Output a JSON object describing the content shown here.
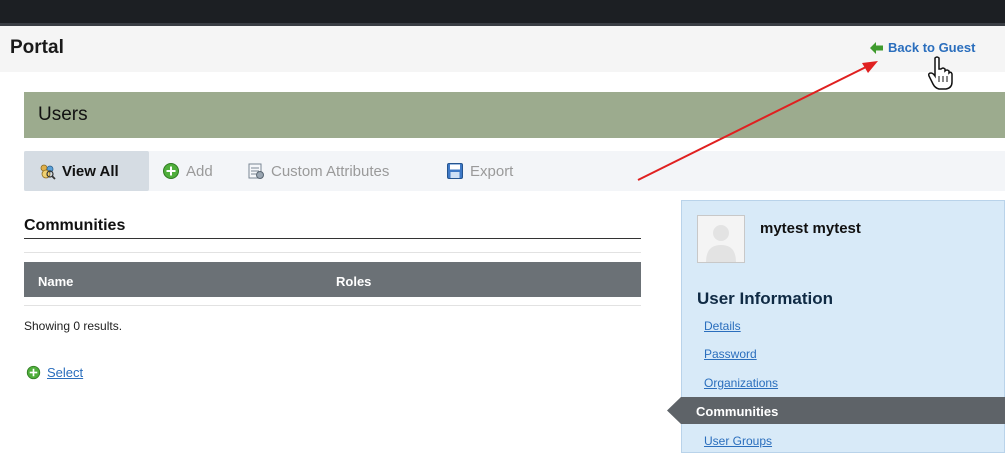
{
  "header": {
    "title": "Portal",
    "back_link": "Back to Guest"
  },
  "section": {
    "title": "Users"
  },
  "toolbar": {
    "items": [
      {
        "label": "View All",
        "icon": "view-all-icon",
        "active": true
      },
      {
        "label": "Add",
        "icon": "add-icon",
        "active": false
      },
      {
        "label": "Custom Attributes",
        "icon": "custom-attributes-icon",
        "active": false
      },
      {
        "label": "Export",
        "icon": "save-icon",
        "active": false
      }
    ]
  },
  "communities": {
    "title": "Communities",
    "columns": [
      "Name",
      "Roles"
    ],
    "status": "Showing 0 results.",
    "select_label": "Select"
  },
  "profile": {
    "name": "mytest mytest",
    "info_heading": "User Information",
    "nav": [
      {
        "label": "Details",
        "active": false
      },
      {
        "label": "Password",
        "active": false
      },
      {
        "label": "Organizations",
        "active": false
      },
      {
        "label": "Communities",
        "active": true
      },
      {
        "label": "User Groups",
        "active": false
      }
    ]
  },
  "colors": {
    "users_bar": "#9cab8e",
    "table_header": "#6b7176",
    "link": "#2a6ebd",
    "panel": "#d8eaf8",
    "annotation_arrow": "#e02020"
  }
}
